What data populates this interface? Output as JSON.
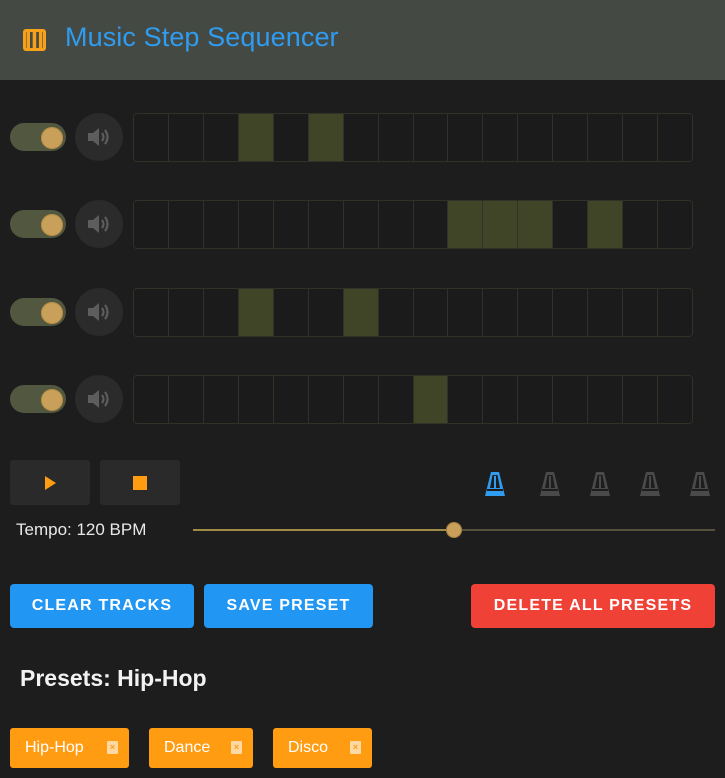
{
  "app": {
    "title": "Music Step Sequencer",
    "logo_icon": "piano-icon",
    "accent_color": "#2f9cf0"
  },
  "tracks": [
    {
      "enabled": true,
      "muted": false,
      "steps": [
        0,
        0,
        0,
        1,
        0,
        1,
        0,
        0,
        0,
        0,
        0,
        0,
        0,
        0,
        0,
        0
      ]
    },
    {
      "enabled": true,
      "muted": false,
      "steps": [
        0,
        0,
        0,
        0,
        0,
        0,
        0,
        0,
        0,
        1,
        1,
        1,
        0,
        1,
        0,
        0
      ]
    },
    {
      "enabled": true,
      "muted": false,
      "steps": [
        0,
        0,
        0,
        1,
        0,
        0,
        1,
        0,
        0,
        0,
        0,
        0,
        0,
        0,
        0,
        0
      ]
    },
    {
      "enabled": true,
      "muted": false,
      "steps": [
        0,
        0,
        0,
        0,
        0,
        0,
        0,
        0,
        1,
        0,
        0,
        0,
        0,
        0,
        0,
        0
      ]
    }
  ],
  "transport": {
    "play_icon": "play-icon",
    "stop_icon": "stop-icon",
    "metronome_icons": [
      "metronome-icon",
      "metronome-icon",
      "metronome-icon",
      "metronome-icon",
      "metronome-icon"
    ],
    "metronome_active_index": 0
  },
  "tempo": {
    "label": "Tempo: 120 BPM",
    "value": 120,
    "slider_fraction": 0.5
  },
  "actions": {
    "clear_label": "CLEAR TRACKS",
    "save_label": "SAVE PRESET",
    "delete_all_label": "DELETE ALL PRESETS"
  },
  "presets": {
    "heading": "Presets: Hip-Hop",
    "items": [
      {
        "label": "Hip-Hop",
        "remove_icon": "close-icon"
      },
      {
        "label": "Dance",
        "remove_icon": "close-icon"
      },
      {
        "label": "Disco",
        "remove_icon": "close-icon"
      }
    ]
  }
}
